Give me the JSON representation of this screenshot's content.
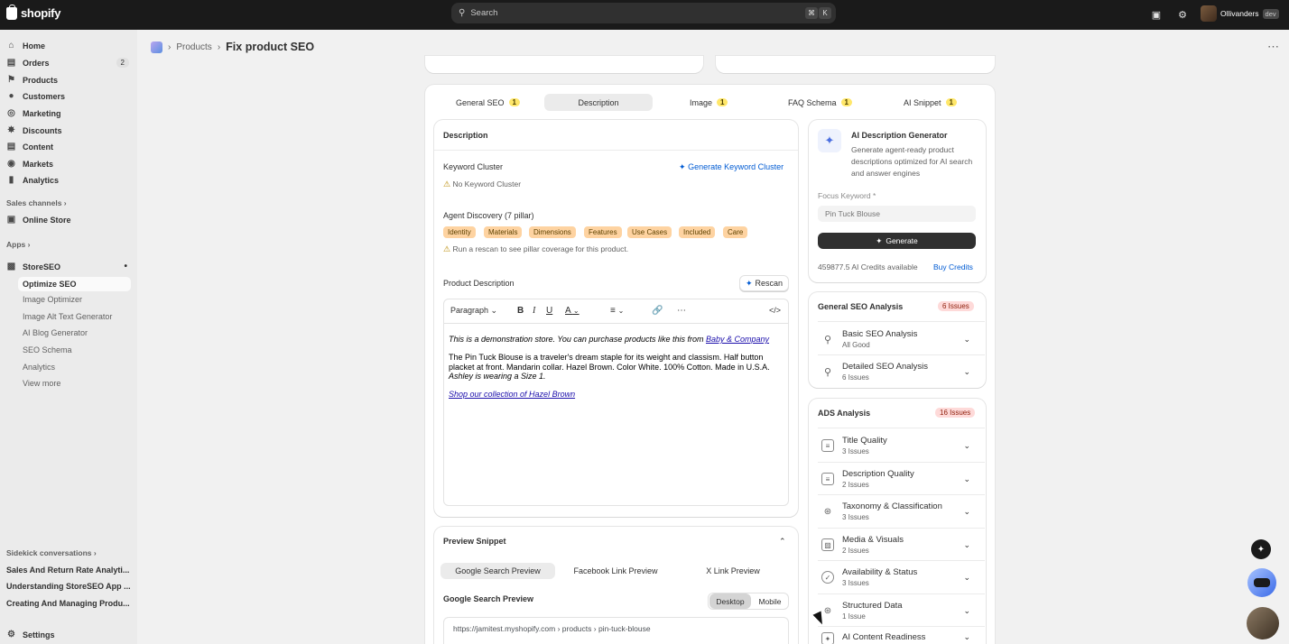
{
  "topbar": {
    "brand": "shopify",
    "search_placeholder": "Search",
    "kbd1": "⌘",
    "kbd2": "K",
    "store_name": "Ollivanders",
    "store_badge": "dev"
  },
  "sidebar": {
    "nav": [
      {
        "label": "Home",
        "icon": "home-icon"
      },
      {
        "label": "Orders",
        "icon": "orders-icon",
        "count": "2"
      },
      {
        "label": "Products",
        "icon": "tag-icon"
      },
      {
        "label": "Customers",
        "icon": "person-icon"
      },
      {
        "label": "Marketing",
        "icon": "target-icon"
      },
      {
        "label": "Discounts",
        "icon": "discount-icon"
      },
      {
        "label": "Content",
        "icon": "content-icon"
      },
      {
        "label": "Markets",
        "icon": "globe-icon"
      },
      {
        "label": "Analytics",
        "icon": "bar-chart-icon"
      }
    ],
    "sales_channels_title": "Sales channels",
    "online_store": "Online Store",
    "apps_title": "Apps",
    "app_name": "StoreSEO",
    "app_subitems": [
      "Optimize SEO",
      "Image Optimizer",
      "Image Alt Text Generator",
      "AI Blog Generator",
      "SEO Schema",
      "Analytics",
      "View more"
    ],
    "sidekick_title": "Sidekick conversations",
    "conversations": [
      "Sales And Return Rate Analyti...",
      "Understanding StoreSEO App ...",
      "Creating And Managing Produ..."
    ],
    "settings": "Settings"
  },
  "breadcrumb": {
    "parent": "Products",
    "title": "Fix product SEO"
  },
  "tabs": [
    {
      "label": "General SEO",
      "count": "1"
    },
    {
      "label": "Description",
      "count": ""
    },
    {
      "label": "Image",
      "count": "1"
    },
    {
      "label": "FAQ Schema",
      "count": "1"
    },
    {
      "label": "AI Snippet",
      "count": "1"
    }
  ],
  "description_card": {
    "title": "Description",
    "keyword_cluster_label": "Keyword Cluster",
    "generate_cluster": "Generate Keyword Cluster",
    "no_cluster": "No Keyword Cluster",
    "agent_discovery": "Agent Discovery (7 pillar)",
    "pillars": [
      "Identity",
      "Materials",
      "Dimensions",
      "Features",
      "Use Cases",
      "Included",
      "Care"
    ],
    "rescan_hint": "Run a rescan to see pillar coverage for this product.",
    "product_description_label": "Product Description",
    "rescan_button": "Rescan",
    "paragraph_select": "Paragraph",
    "editor": {
      "line1_text": "This is a demonstration store. You can purchase products like this from ",
      "line1_link": "Baby & Company",
      "para2": "The Pin Tuck Blouse is a traveler's dream staple for its weight and classism. Half button placket at front. Mandarin collar. Hazel Brown. Color White. 100% Cotton. Made in U.S.A. ",
      "para2_italic": "Ashley is wearing a Size 1.",
      "link2": "Shop our collection of Hazel Brown"
    }
  },
  "preview_card": {
    "title": "Preview Snippet",
    "tabs": [
      "Google Search Preview",
      "Facebook Link Preview",
      "X Link Preview"
    ],
    "google_title": "Google Search Preview",
    "desktop": "Desktop",
    "mobile": "Mobile",
    "url_parts": [
      "https://jamitest.myshopify.com",
      "products",
      "pin-tuck-blouse"
    ]
  },
  "ai_generator": {
    "title": "AI Description Generator",
    "desc": "Generate agent-ready product descriptions optimized for AI search and answer engines",
    "focus_label": "Focus Keyword",
    "focus_required": "*",
    "focus_placeholder": "Pin Tuck Blouse",
    "generate": "Generate",
    "credits": "459877.5 AI Credits available",
    "buy": "Buy Credits"
  },
  "general_seo": {
    "title": "General SEO Analysis",
    "badge": "6 Issues",
    "rows": [
      {
        "title": "Basic SEO Analysis",
        "sub": "All Good"
      },
      {
        "title": "Detailed SEO Analysis",
        "sub": "6 Issues"
      }
    ]
  },
  "ads": {
    "title": "ADS Analysis",
    "badge": "16 Issues",
    "rows": [
      {
        "title": "Title Quality",
        "sub": "3 Issues",
        "icon": "document-icon"
      },
      {
        "title": "Description Quality",
        "sub": "2 Issues",
        "icon": "document-icon"
      },
      {
        "title": "Taxonomy & Classification",
        "sub": "3 Issues",
        "icon": "hierarchy-icon"
      },
      {
        "title": "Media & Visuals",
        "sub": "2 Issues",
        "icon": "image-icon"
      },
      {
        "title": "Availability & Status",
        "sub": "3 Issues",
        "icon": "clock-icon"
      },
      {
        "title": "Structured Data",
        "sub": "1 Issue",
        "icon": "hierarchy-icon"
      },
      {
        "title": "AI Content Readiness",
        "sub": "",
        "icon": "sparkle-icon"
      }
    ]
  }
}
